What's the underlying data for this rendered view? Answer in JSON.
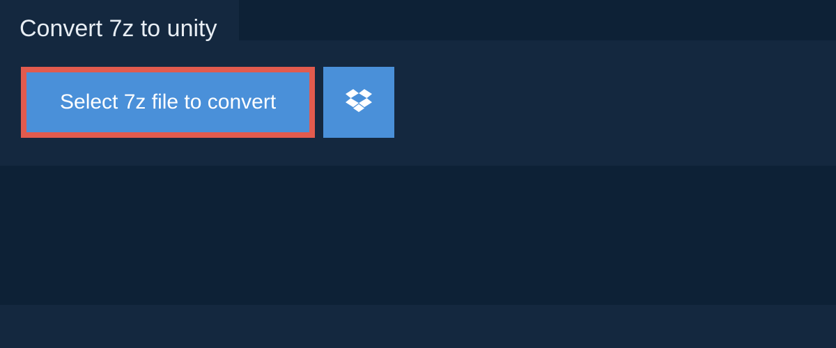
{
  "header": {
    "tab_label": "Convert 7z to unity"
  },
  "panel": {
    "select_button_label": "Select 7z file to convert"
  }
}
